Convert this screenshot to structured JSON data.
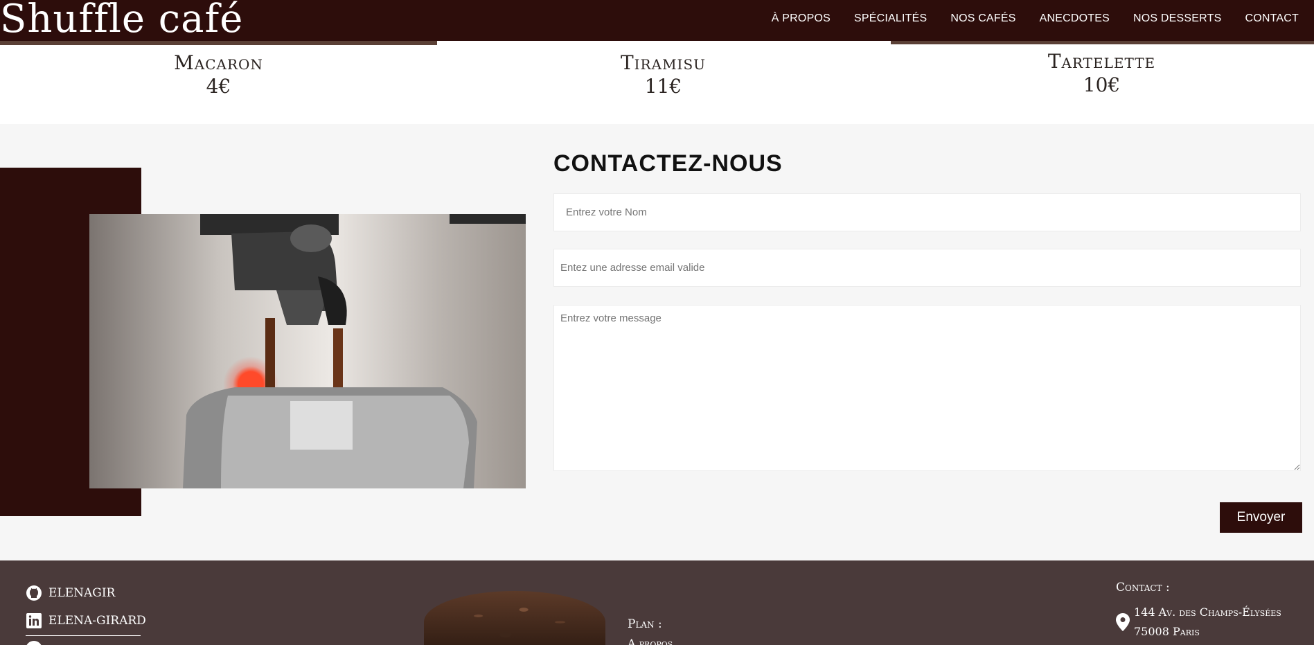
{
  "header": {
    "brand": "Shuffle café",
    "nav": [
      "À PROPOS",
      "SPÉCIALITÉS",
      "NOS CAFÉS",
      "ANECDOTES",
      "NOS DESSERTS",
      "CONTACT"
    ]
  },
  "desserts": [
    {
      "name": "Macaron",
      "price": "4€"
    },
    {
      "name": "Tiramisu",
      "price": "11€"
    },
    {
      "name": "Tartelette",
      "price": "10€"
    }
  ],
  "contact": {
    "title": "CONTACTEZ-NOUS",
    "name_placeholder": "Entrez votre Nom",
    "email_placeholder": "Entez une adresse email valide",
    "message_placeholder": "Entrez votre message",
    "send_label": "Envoyer"
  },
  "footer": {
    "github": "elenagir",
    "linkedin": "elena-girard",
    "plan_title": "Plan :",
    "plan_link": "A propos",
    "contact_title": "Contact :",
    "address_line1": "144 Av. des Champs-Élysées",
    "address_line2": "75008 Paris"
  },
  "icons": [
    "github-icon",
    "linkedin-icon",
    "map-pin-icon"
  ],
  "colors": {
    "brand": "#2d0d0b",
    "footer": "#4a3a3a",
    "section_bg": "#f6f6f6"
  }
}
